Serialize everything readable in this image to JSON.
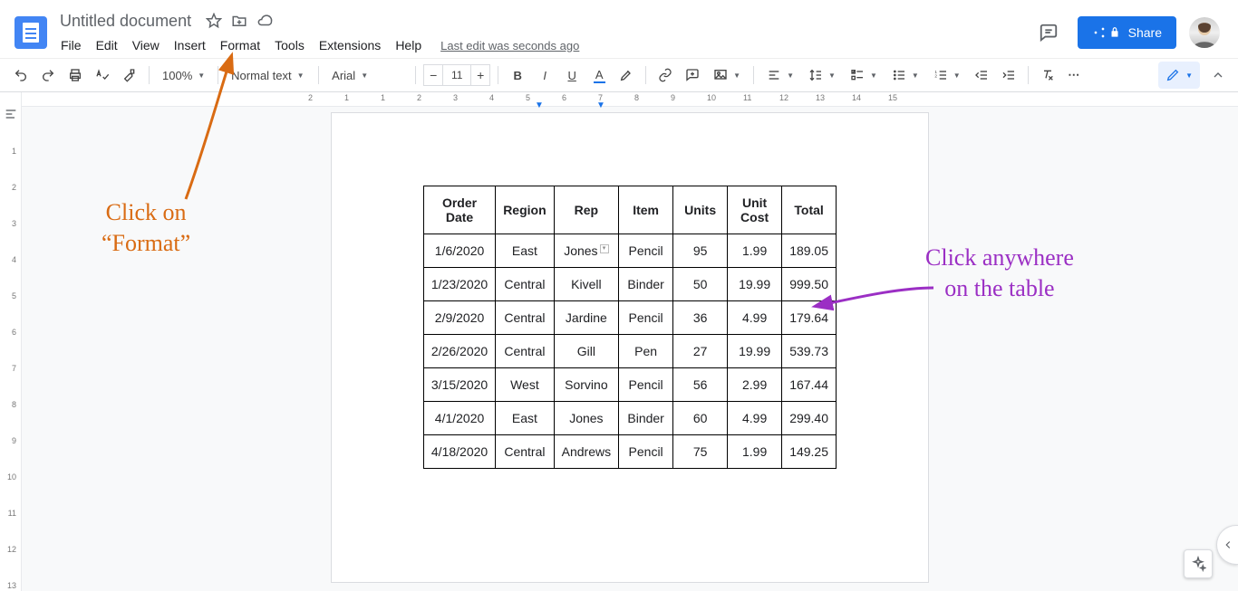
{
  "app": {
    "title": "Untitled document",
    "last_edit": "Last edit was seconds ago",
    "share_label": "Share"
  },
  "menus": [
    "File",
    "Edit",
    "View",
    "Insert",
    "Format",
    "Tools",
    "Extensions",
    "Help"
  ],
  "toolbar": {
    "zoom": "100%",
    "style": "Normal text",
    "font": "Arial",
    "font_size": "11"
  },
  "hruler_ticks": [
    "2",
    "1",
    "1",
    "2",
    "3",
    "4",
    "5",
    "6",
    "7",
    "8",
    "9",
    "10",
    "11",
    "12",
    "13",
    "14",
    "15"
  ],
  "vruler_ticks": [
    "1",
    "2",
    "3",
    "4",
    "5",
    "6",
    "7",
    "8",
    "9",
    "10",
    "11",
    "12",
    "13"
  ],
  "table": {
    "headers": [
      "Order Date",
      "Region",
      "Rep",
      "Item",
      "Units",
      "Unit Cost",
      "Total"
    ],
    "rows": [
      [
        "1/6/2020",
        "East",
        "Jones",
        "Pencil",
        "95",
        "1.99",
        "189.05"
      ],
      [
        "1/23/2020",
        "Central",
        "Kivell",
        "Binder",
        "50",
        "19.99",
        "999.50"
      ],
      [
        "2/9/2020",
        "Central",
        "Jardine",
        "Pencil",
        "36",
        "4.99",
        "179.64"
      ],
      [
        "2/26/2020",
        "Central",
        "Gill",
        "Pen",
        "27",
        "19.99",
        "539.73"
      ],
      [
        "3/15/2020",
        "West",
        "Sorvino",
        "Pencil",
        "56",
        "2.99",
        "167.44"
      ],
      [
        "4/1/2020",
        "East",
        "Jones",
        "Binder",
        "60",
        "4.99",
        "299.40"
      ],
      [
        "4/18/2020",
        "Central",
        "Andrews",
        "Pencil",
        "75",
        "1.99",
        "149.25"
      ]
    ]
  },
  "annotations": {
    "format_line1": "Click on",
    "format_line2": "“Format”",
    "table_line1": "Click anywhere",
    "table_line2": "on the table"
  }
}
